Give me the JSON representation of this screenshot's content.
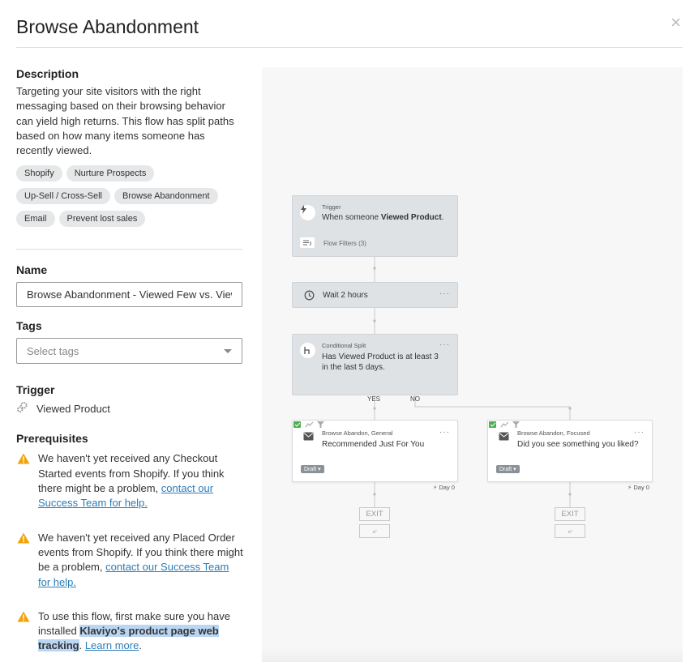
{
  "header": {
    "title": "Browse Abandonment",
    "close_symbol": "×"
  },
  "description": {
    "heading": "Description",
    "text": "Targeting your site visitors with the right messaging based on their browsing behavior can yield high returns. This flow has split paths based on how many items someone has recently viewed."
  },
  "chips": [
    "Shopify",
    "Nurture Prospects",
    "Up-Sell / Cross-Sell",
    "Browse Abandonment",
    "Email",
    "Prevent lost sales"
  ],
  "name_field": {
    "label": "Name",
    "value": "Browse Abandonment - Viewed Few vs. Viewed Many"
  },
  "tags_field": {
    "label": "Tags",
    "placeholder": "Select tags"
  },
  "trigger": {
    "heading": "Trigger",
    "value": "Viewed Product"
  },
  "prerequisites": {
    "heading": "Prerequisites",
    "items": [
      {
        "text": "We haven't yet received any Checkout Started events from Shopify.",
        "strong": "If you think there might be a problem,",
        "link": "contact our Success Team for help."
      },
      {
        "text": "We haven't yet received any Placed Order events from Shopify.",
        "strong": "If you think there might be a problem,",
        "link": "contact our Success Team for help."
      }
    ],
    "last": {
      "text": "To use this flow, first make sure you have installed",
      "highlight": "Klaviyo's product page web tracking",
      "link": "Learn more",
      "end": "."
    }
  },
  "flow": {
    "trigger": {
      "label": "Trigger",
      "text_prefix": "When someone",
      "text_bold": "Viewed Product",
      "text_end": ".",
      "filters": "Flow Filters (3)"
    },
    "wait": {
      "text": "Wait 2 hours"
    },
    "split": {
      "label": "Conditional Split",
      "line1_prefix": "Has",
      "line1_bold": "Viewed Product",
      "line1_end": "is at least 3",
      "line2_prefix": "in the last",
      "line2_bold": "5 days",
      "line2_end": "."
    },
    "yes_label": "YES",
    "no_label": "NO",
    "email_left": {
      "label": "Browse Abandon, General",
      "text": "Recommended Just For You",
      "status": "Draft",
      "day": "Day 0"
    },
    "email_right": {
      "label": "Browse Abandon, Focused",
      "text": "Did you see something you liked?",
      "status": "Draft",
      "day": "Day 0"
    },
    "exit_label": "EXIT",
    "more_symbol": "···",
    "return_symbol": "⤶"
  },
  "colors": {
    "link": "#2b7cb7",
    "warning": "#f0a30a",
    "highlight": "#bad6f3"
  }
}
